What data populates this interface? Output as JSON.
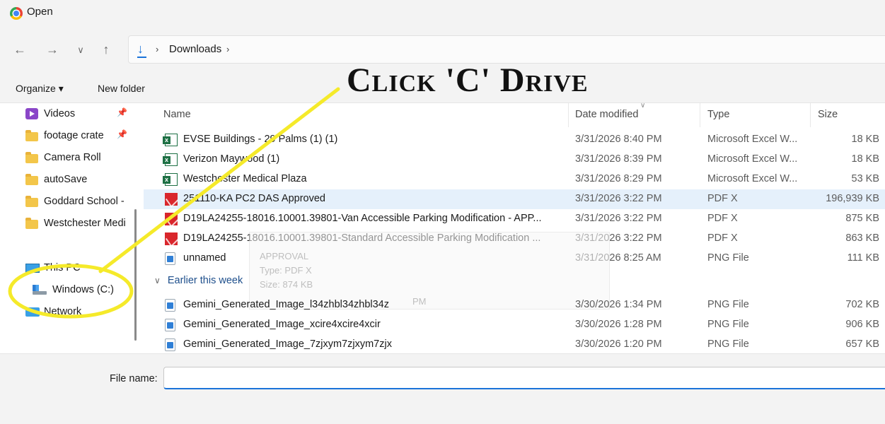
{
  "window": {
    "title": "Open"
  },
  "nav": {
    "back": "←",
    "forward": "→",
    "recent": "∨",
    "up": "↑",
    "download_glyph": "↓",
    "sep1": "›",
    "breadcrumb": "Downloads",
    "sep2": "›"
  },
  "toolbar": {
    "organize": "Organize ▾",
    "new_folder": "New folder"
  },
  "annotation": {
    "banner": "Click 'C' Drive",
    "highlight_color": "#f5ea2a"
  },
  "sidebar": {
    "items": [
      {
        "label": "Videos",
        "icon": "videos-icon",
        "pinned": true
      },
      {
        "label": "footage crate",
        "icon": "folder-icon",
        "pinned": true
      },
      {
        "label": "Camera Roll",
        "icon": "folder-icon"
      },
      {
        "label": "autoSave",
        "icon": "folder-icon"
      },
      {
        "label": "Goddard School -",
        "icon": "folder-icon"
      },
      {
        "label": "Westchester Medi",
        "icon": "folder-icon"
      },
      {
        "label": "This PC",
        "icon": "pc-icon"
      },
      {
        "label": "Windows (C:)",
        "icon": "drive-icon"
      },
      {
        "label": "Network",
        "icon": "network-icon"
      }
    ],
    "pin_glyph": "📌"
  },
  "columns": {
    "name": "Name",
    "date": "Date modified",
    "type": "Type",
    "size": "Size",
    "sort_glyph": "∨"
  },
  "files": [
    {
      "name": "EVSE Buildings - 29 Palms (1) (1)",
      "date": "3/31/2026 8:40 PM",
      "type": "Microsoft Excel W...",
      "size": "18 KB",
      "icon": "excel"
    },
    {
      "name": "Verizon Maywood (1)",
      "date": "3/31/2026 8:39 PM",
      "type": "Microsoft Excel W...",
      "size": "18 KB",
      "icon": "excel"
    },
    {
      "name": "Westchester Medical Plaza",
      "date": "3/31/2026 8:29 PM",
      "type": "Microsoft Excel W...",
      "size": "53 KB",
      "icon": "excel"
    },
    {
      "name": "251110-KA PC2 DAS Approved",
      "date": "3/31/2026 3:22 PM",
      "type": "PDF X",
      "size": "196,939 KB",
      "icon": "pdf",
      "selected": true
    },
    {
      "name": "D19LA24255-18016.10001.39801-Van Accessible Parking Modification - APP...",
      "date": "3/31/2026 3:22 PM",
      "type": "PDF X",
      "size": "875 KB",
      "icon": "pdf"
    },
    {
      "name": "D19LA24255-18016.10001.39801-Standard Accessible Parking Modification ...",
      "date": "3/31/2026 3:22 PM",
      "type": "PDF X",
      "size": "863 KB",
      "icon": "pdf"
    },
    {
      "name": "unnamed",
      "date": "3/31/2026 8:25 AM",
      "type": "PNG File",
      "size": "111 KB",
      "icon": "png"
    }
  ],
  "group_earlier": {
    "label": "Earlier this week"
  },
  "files_earlier": [
    {
      "name": "Gemini_Generated_Image_l34zhbl34zhbl34z",
      "date": "3/30/2026 1:34 PM",
      "type": "PNG File",
      "size": "702 KB",
      "icon": "png"
    },
    {
      "name": "Gemini_Generated_Image_xcire4xcire4xcir",
      "date": "3/30/2026 1:28 PM",
      "type": "PNG File",
      "size": "906 KB",
      "icon": "png"
    },
    {
      "name": "Gemini_Generated_Image_7zjxym7zjxym7zjx",
      "date": "3/30/2026 1:20 PM",
      "type": "PNG File",
      "size": "657 KB",
      "icon": "png"
    }
  ],
  "tooltip": {
    "line1": "APPROVAL",
    "line2": "Type: PDF X",
    "line3": "Size: 874 KB",
    "line4": "PM"
  },
  "footer": {
    "file_name_label": "File name:",
    "file_name_value": ""
  }
}
